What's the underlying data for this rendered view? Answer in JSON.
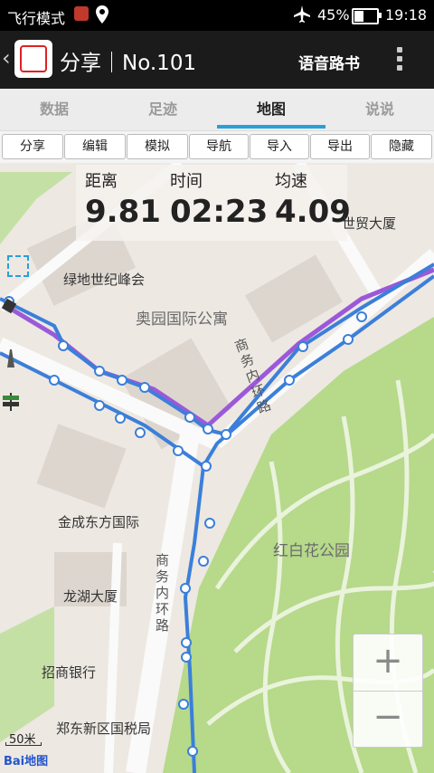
{
  "status_bar": {
    "mode": "飞行模式",
    "battery": "45%",
    "time": "19:18"
  },
  "app_bar": {
    "title": "分享｜No.101",
    "voice_button": "语音路书"
  },
  "tabs": [
    "数据",
    "足迹",
    "地图",
    "说说"
  ],
  "active_tab": "地图",
  "toolbar": [
    "分享",
    "编辑",
    "模拟",
    "导航",
    "导入",
    "导出",
    "隐藏"
  ],
  "stats": {
    "distance_label": "距离",
    "distance_value": "9.81",
    "time_label": "时间",
    "time_value": "02:23",
    "speed_label": "均速",
    "speed_value": "4.09"
  },
  "map": {
    "poi_1": "绿地世纪峰会",
    "poi_2": "奥园国际公寓",
    "poi_3": "金成东方国际",
    "poi_4": "龙湖大厦",
    "poi_5": "招商银行",
    "poi_6": "郑东新区国税局",
    "poi_7": "世贸大厦",
    "park": "红白花公园",
    "road_1": "商务内环路",
    "road_2": "商务内环路",
    "scale": "50米",
    "logo": "Bai地图",
    "zoom_in": "+",
    "zoom_out": "−"
  },
  "colors": {
    "accent": "#2a9fd8",
    "track": "#3b7fd9",
    "track_alt": "#9b59d9",
    "park": "#b6d98a"
  }
}
